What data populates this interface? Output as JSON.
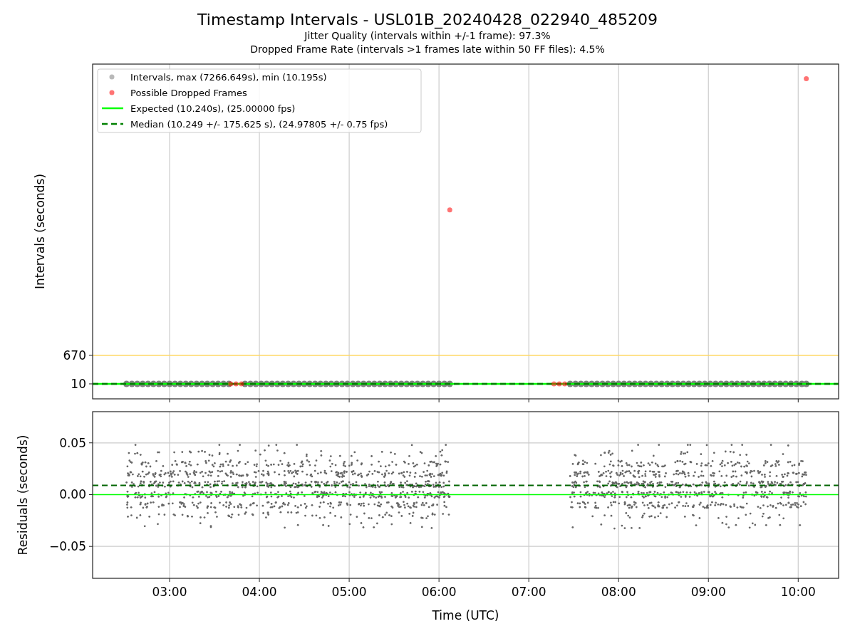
{
  "figure": {
    "title": "Timestamp Intervals - USL01B_20240428_022940_485209",
    "subtitles": [
      "Jitter Quality (intervals within +/-1 frame): 97.3%",
      "Dropped Frame Rate (intervals >1 frames late within 50 FF files): 4.5%"
    ]
  },
  "plots": [
    {
      "chart_data": {
        "type": "scatter",
        "ylabel": "Intervals (seconds)",
        "xlim": [
          2.143,
          10.45
        ],
        "ylim": [
          -337,
          7418
        ],
        "yticks": [
          10,
          670
        ],
        "series": [
          {
            "name": "Intervals, max (7266.649s), min (10.195s)",
            "color": "#808080",
            "x": [
              2.52,
              2.58,
              2.64,
              2.7,
              2.76,
              2.82,
              2.88,
              2.94,
              3.0,
              3.06,
              3.12,
              3.18,
              3.24,
              3.3,
              3.36,
              3.42,
              3.48,
              3.54,
              3.6,
              3.66,
              3.84,
              3.9,
              3.96,
              4.02,
              4.08,
              4.14,
              4.2,
              4.26,
              4.32,
              4.38,
              4.44,
              4.5,
              4.56,
              4.62,
              4.68,
              4.74,
              4.8,
              4.86,
              4.92,
              4.98,
              5.04,
              5.1,
              5.16,
              5.22,
              5.28,
              5.34,
              5.4,
              5.46,
              5.52,
              5.58,
              5.64,
              5.7,
              5.76,
              5.82,
              5.88,
              5.94,
              6.0,
              6.06,
              6.12,
              7.46,
              7.52,
              7.58,
              7.64,
              7.7,
              7.76,
              7.82,
              7.88,
              7.94,
              8.0,
              8.06,
              8.12,
              8.18,
              8.24,
              8.3,
              8.36,
              8.42,
              8.48,
              8.54,
              8.6,
              8.66,
              8.72,
              8.78,
              8.84,
              8.9,
              8.96,
              9.02,
              9.08,
              9.14,
              9.2,
              9.26,
              9.32,
              9.38,
              9.44,
              9.5,
              9.56,
              9.62,
              9.68,
              9.74,
              9.8,
              9.86,
              9.92,
              9.98,
              10.04,
              10.09
            ],
            "values": [
              10,
              10,
              10,
              10,
              10,
              10,
              10,
              10,
              10,
              10,
              10,
              10,
              10,
              10,
              10,
              10,
              10,
              10,
              10,
              10,
              10,
              10,
              10,
              10,
              10,
              10,
              10,
              10,
              10,
              10,
              10,
              10,
              10,
              10,
              10,
              10,
              10,
              10,
              10,
              10,
              10,
              10,
              10,
              10,
              10,
              10,
              10,
              10,
              10,
              10,
              10,
              10,
              10,
              10,
              10,
              10,
              10,
              10,
              10,
              10,
              10,
              10,
              10,
              10,
              10,
              10,
              10,
              10,
              10,
              10,
              10,
              10,
              10,
              10,
              10,
              10,
              10,
              10,
              10,
              10,
              10,
              10,
              10,
              10,
              10,
              10,
              10,
              10,
              10,
              10,
              10,
              10,
              10,
              10,
              10,
              10,
              10,
              10,
              10,
              10,
              10,
              10,
              10,
              10
            ]
          },
          {
            "name": "Possible Dropped Frames",
            "color": "#ff0000",
            "x": [
              3.68,
              3.74,
              3.8,
              6.12,
              7.28,
              7.34,
              7.4,
              10.09
            ],
            "values": [
              10,
              10,
              10,
              4040,
              10,
              10,
              10,
              7080
            ]
          }
        ],
        "ref_lines": [
          {
            "axis": "y",
            "value": 670,
            "color": "#ffd966"
          },
          {
            "axis": "y",
            "value": 10,
            "label": "Expected (10.240s), (25.00000 fps)",
            "color": "#00ff00"
          },
          {
            "axis": "y",
            "value": 10,
            "label": "Median (10.249 +/- 175.625 s), (24.97805 +/- 0.75 fps)",
            "color": "#008000"
          }
        ],
        "grid": "x",
        "legend": "upper left"
      }
    },
    {
      "chart_data": {
        "type": "scatter",
        "xlabel": "Time (UTC)",
        "ylabel": "Residuals (seconds)",
        "xlim": [
          2.143,
          10.45
        ],
        "ylim": [
          -0.0808,
          0.0801
        ],
        "xticks": [
          {
            "value": 3,
            "label": "03:00"
          },
          {
            "value": 4,
            "label": "04:00"
          },
          {
            "value": 5,
            "label": "05:00"
          },
          {
            "value": 6,
            "label": "06:00"
          },
          {
            "value": 7,
            "label": "07:00"
          },
          {
            "value": 8,
            "label": "08:00"
          },
          {
            "value": 9,
            "label": "09:00"
          },
          {
            "value": 10,
            "label": "10:00"
          }
        ],
        "yticks": [
          {
            "value": 0.05,
            "label": "0.05"
          },
          {
            "value": 0,
            "label": "0.00"
          },
          {
            "value": -0.05,
            "label": "−0.05"
          }
        ],
        "ref_lines": [
          {
            "axis": "y",
            "value": 0,
            "color": "#00ff00"
          },
          {
            "axis": "y",
            "value": 0.009,
            "color": "#006400"
          }
        ],
        "grid": "both"
      }
    }
  ]
}
